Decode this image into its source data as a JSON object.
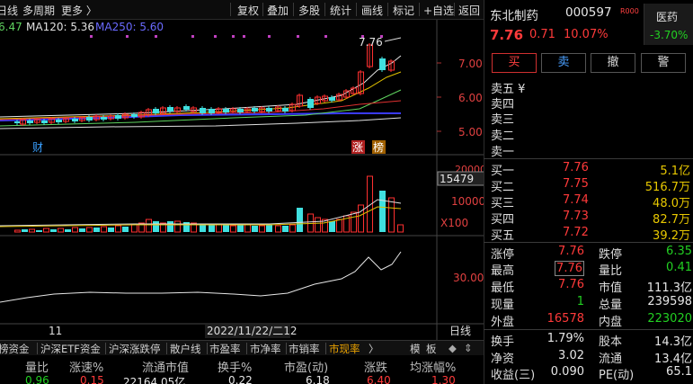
{
  "toolbar": {
    "left_items": [
      "日线",
      "多周期",
      "更多 〉"
    ],
    "right_items": [
      "复权",
      "叠加",
      "多股",
      "统计",
      "画线",
      "标记",
      "+自选",
      "返回"
    ]
  },
  "ma_legend": {
    "ma_prev": "6.47",
    "ma120": "MA120: 5.36",
    "ma250": "MA250: 5.60"
  },
  "chart_annotations": {
    "high_label": "7.76",
    "badge_cai": "财",
    "badge_zhang": "涨",
    "badge_bang": "榜"
  },
  "chart_data": {
    "type": "candlestick",
    "price_axis": [
      "7.00",
      "6.00",
      "5.00"
    ],
    "volume_axis": [
      "20000",
      "15479",
      "10000"
    ],
    "volume_unit": "X100",
    "indicator_axis": [
      "30.00"
    ],
    "x_axis": [
      "11",
      "2022/11/22/二12"
    ],
    "last_volume": 15479
  },
  "bottom_tabs": [
    "榜资金",
    "沪深ETF资金",
    "沪深涨跌停",
    "散户线",
    "市盈率",
    "市净率",
    "市销率",
    "市现率",
    "〉",
    "模",
    "板",
    "◆"
  ],
  "bottom_header": [
    "量比",
    "涨速%",
    "流通市值",
    "换手%",
    "市盈(动)",
    "涨跌",
    "均涨幅%"
  ],
  "bottom_values": [
    "0.96",
    "0.15",
    "22164.05亿",
    "0.22",
    "6.18",
    "6.40",
    "1.30"
  ],
  "right_label": "日线",
  "stock": {
    "name": "东北制药",
    "code": "000597",
    "tag": "R000",
    "price": "7.76",
    "change": "0.71",
    "pct": "10.07%",
    "sector_name": "医药",
    "sector_pct": "-3.70%"
  },
  "trade_buttons": [
    "买",
    "卖",
    "撤",
    "警"
  ],
  "sell_orders": [
    {
      "label": "卖五 ¥",
      "price": "",
      "vol": ""
    },
    {
      "label": "卖四",
      "price": "",
      "vol": ""
    },
    {
      "label": "卖三",
      "price": "",
      "vol": ""
    },
    {
      "label": "卖二",
      "price": "",
      "vol": ""
    },
    {
      "label": "卖一",
      "price": "",
      "vol": ""
    }
  ],
  "buy_orders": [
    {
      "label": "买一",
      "price": "7.76",
      "vol": "5.1亿"
    },
    {
      "label": "买二",
      "price": "7.75",
      "vol": "516.7万"
    },
    {
      "label": "买三",
      "price": "7.74",
      "vol": "48.0万"
    },
    {
      "label": "买四",
      "price": "7.73",
      "vol": "82.7万"
    },
    {
      "label": "买五",
      "price": "7.72",
      "vol": "39.2万"
    }
  ],
  "stats_block1": [
    {
      "l1": "涨停",
      "v1": "7.76",
      "c1": "red",
      "l2": "跌停",
      "v2": "6.35",
      "c2": "green"
    },
    {
      "l1": "最高",
      "v1": "7.76",
      "c1": "red",
      "l2": "量比",
      "v2": "0.41",
      "c2": "green"
    },
    {
      "l1": "最低",
      "v1": "7.76",
      "c1": "red",
      "l2": "市值",
      "v2": "111.3亿",
      "c2": "white"
    },
    {
      "l1": "现量",
      "v1": "1",
      "c1": "green",
      "l2": "总量",
      "v2": "239598",
      "c2": "white"
    },
    {
      "l1": "外盘",
      "v1": "16578",
      "c1": "red",
      "l2": "内盘",
      "v2": "223020",
      "c2": "green"
    }
  ],
  "stats_block2": [
    {
      "l1": "换手",
      "v1": "1.79%",
      "c1": "white",
      "l2": "股本",
      "v2": "14.3亿",
      "c2": "white"
    },
    {
      "l1": "净资",
      "v1": "3.02",
      "c1": "white",
      "l2": "流通",
      "v2": "13.4亿",
      "c2": "white"
    },
    {
      "l1": "收益(三)",
      "v1": "0.090",
      "c1": "white",
      "l2": "PE(动)",
      "v2": "65.1",
      "c2": "white"
    }
  ]
}
